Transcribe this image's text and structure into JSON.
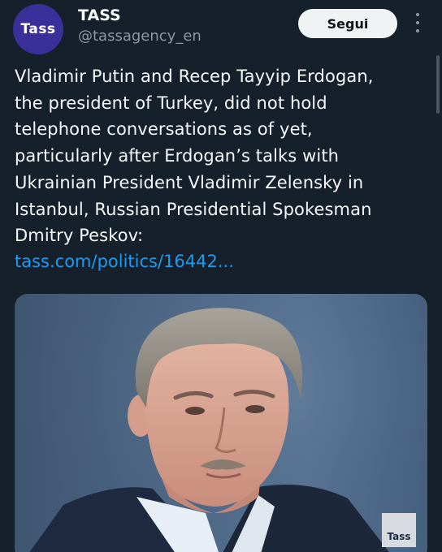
{
  "account": {
    "avatar_text": "Tass",
    "display_name": "TASS",
    "handle": "@tassagency_en"
  },
  "actions": {
    "follow_label": "Segui",
    "more_icon": "more-vertical-icon"
  },
  "tweet": {
    "text_lines": [
      "Vladimir Putin and Recep Tayyip Erdogan,",
      "the president of Turkey, did not hold",
      "telephone conversations as of yet,",
      "particularly after Erdogan’s talks with",
      "Ukrainian President Vladimir Zelensky in",
      "Istanbul, Russian Presidential Spokesman",
      "Dmitry Peskov:"
    ],
    "link": "tass.com/politics/16442..."
  },
  "media": {
    "watermark_text": "Tass"
  },
  "colors": {
    "background": "#15202b",
    "text_primary": "#f7f9f9",
    "text_secondary": "#8b98a5",
    "link": "#1d9bf0",
    "avatar_bg": "#3b2f9a",
    "follow_bg": "#eff3f4"
  }
}
